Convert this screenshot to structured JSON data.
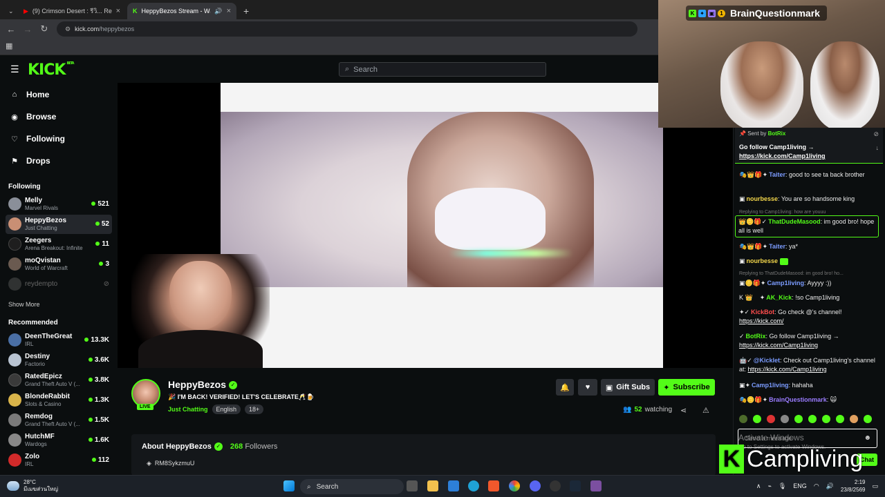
{
  "browser": {
    "tabs": [
      {
        "label": "(9) Crimson Desert : รีวิ... Revie"
      },
      {
        "label": "HeppyBezos Stream - Watc"
      }
    ],
    "url_host": "kick.com",
    "url_path": "/heppybezos"
  },
  "header": {
    "logo": "KICK",
    "logo_beta": "BETA",
    "search_placeholder": "Search"
  },
  "sidebar": {
    "nav": [
      {
        "label": "Home",
        "icon": "home-icon"
      },
      {
        "label": "Browse",
        "icon": "compass-icon"
      },
      {
        "label": "Following",
        "icon": "heart-icon"
      },
      {
        "label": "Drops",
        "icon": "gift-icon"
      }
    ],
    "following_title": "Following",
    "following": [
      {
        "name": "Melly",
        "category": "Marvel Rivals",
        "viewers": "521",
        "color": "#8a8f99"
      },
      {
        "name": "HeppyBezos",
        "category": "Just Chatting",
        "viewers": "52",
        "color": "#c98f74"
      },
      {
        "name": "Zeegers",
        "category": "Arena Breakout: Infinite",
        "viewers": "11",
        "color": "#1e1e1e"
      },
      {
        "name": "moQvistan",
        "category": "World of Warcraft",
        "viewers": "3",
        "color": "#6a5a50"
      }
    ],
    "offline": {
      "name": "reydempto"
    },
    "show_more": "Show More",
    "recommended_title": "Recommended",
    "recommended": [
      {
        "name": "DeenTheGreat",
        "category": "IRL",
        "viewers": "13.3K",
        "color": "#4a6fa5"
      },
      {
        "name": "Destiny",
        "category": "Factorio",
        "viewers": "3.6K",
        "color": "#b9c4d2"
      },
      {
        "name": "RatedEpicz",
        "category": "Grand Theft Auto V (...",
        "viewers": "3.8K",
        "color": "#3a3a3a"
      },
      {
        "name": "BlondeRabbit",
        "category": "Slots & Casino",
        "viewers": "1.3K",
        "color": "#d9b44a"
      },
      {
        "name": "Remdog",
        "category": "Grand Theft Auto V (...",
        "viewers": "1.5K",
        "color": "#7a7a7a"
      },
      {
        "name": "HutchMF",
        "category": "Wardogs",
        "viewers": "1.6K",
        "color": "#888"
      },
      {
        "name": "Zolo",
        "category": "IRL",
        "viewers": "112",
        "color": "#d12a2a"
      }
    ]
  },
  "overlay": {
    "name": "BrainQuestionmark"
  },
  "stream": {
    "streamer": "HeppyBezos",
    "live": "LIVE",
    "title": "🎉 I'M BACK! VERIFIED! LET'S CELEBRATE🥂🍺",
    "category": "Just Chatting",
    "tags": [
      "English",
      "18+"
    ],
    "gift_subs": "Gift Subs",
    "subscribe": "Subscribe",
    "watching_count": "52",
    "watching_label": "watching",
    "about_title": "About HeppyBezos",
    "followers_count": "268",
    "followers_label": "Followers",
    "discord": "RM8SykzmuU"
  },
  "chat": {
    "pinned_sent_by": "Sent by",
    "pinned_user": "BotRix",
    "pinned_msg": "Go follow Camp1living →",
    "pinned_link": "https://kick.com/Camp1living",
    "messages": [
      {
        "user": "Taiter",
        "color": "#7c9cff",
        "text": ": good to see ta back brother"
      },
      {
        "user": "nourbesse",
        "color": "#f2d64b",
        "text": ": You are so handsome king"
      },
      {
        "reply": "Replying to Camp1living: how are youuu",
        "user": "ThatDudeMasood",
        "color": "#53fc18",
        "text": ": im good bro! hope all is well"
      },
      {
        "user": "Taiter",
        "color": "#7c9cff",
        "text": ": ya*"
      },
      {
        "user": "nourbesse",
        "color": "#f2d64b",
        "text": ":"
      },
      {
        "reply": "Replying to ThatDudeMasood: im good bro! ho...",
        "user": "Camp1living",
        "color": "#7c9cff",
        "text": ": Ayyyy :))"
      },
      {
        "user": "AK_Kick",
        "color": "#53fc18",
        "text": ": !so Camp1living"
      },
      {
        "user": "KickBot",
        "color": "#ff4d4d",
        "text": ": Go check @'s channel!",
        "link": "https://kick.com/"
      },
      {
        "user": "BotRix",
        "color": "#53fc18",
        "text": ": Go follow Camp1living →",
        "link": "https://kick.com/Camp1living"
      },
      {
        "user": "@Kicklet",
        "color": "#7c9cff",
        "text": ": Check out Camp1living's channel at:",
        "link": "https://kick.com/Camp1living"
      },
      {
        "user": "Camp1living",
        "color": "#7c9cff",
        "text": ": hahaha"
      },
      {
        "user": "BrainQuestionmark",
        "color": "#9a7cff",
        "text": ":"
      }
    ],
    "input_placeholder": "Send a message",
    "chat_button": "Chat"
  },
  "watermark": {
    "brand": "Campliving",
    "activate_title": "Activate Windows",
    "activate_sub": "Go to Settings to activate Windows."
  },
  "taskbar": {
    "temp": "28°C",
    "weather_text": "มีเมฆส่วนใหญ่",
    "search": "Search",
    "lang": "ENG",
    "time": "2:19",
    "date": "23/8/2569"
  }
}
